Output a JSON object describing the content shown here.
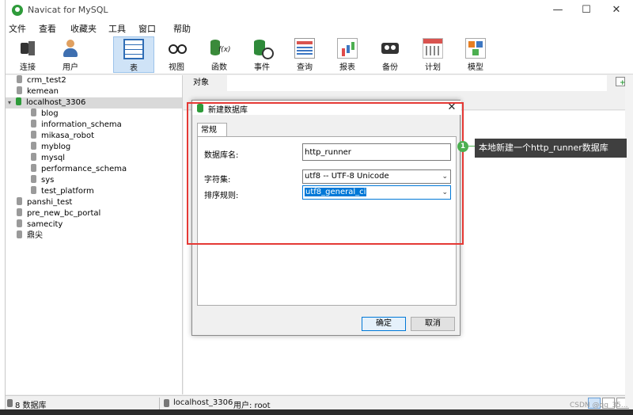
{
  "window": {
    "title": "Navicat for MySQL",
    "minimize": "—",
    "maximize": "☐",
    "close": "✕"
  },
  "menu": [
    "文件",
    "查看",
    "收藏夹",
    "工具",
    "窗口",
    "帮助"
  ],
  "toolbar": [
    {
      "label": "连接",
      "icon": "plug-icon"
    },
    {
      "label": "用户",
      "icon": "user-icon"
    },
    {
      "label": "表",
      "icon": "table-icon",
      "active": true
    },
    {
      "label": "视图",
      "icon": "view-icon"
    },
    {
      "label": "函数",
      "icon": "function-icon"
    },
    {
      "label": "事件",
      "icon": "event-icon"
    },
    {
      "label": "查询",
      "icon": "query-icon"
    },
    {
      "label": "报表",
      "icon": "report-icon"
    },
    {
      "label": "备份",
      "icon": "backup-icon"
    },
    {
      "label": "计划",
      "icon": "schedule-icon"
    },
    {
      "label": "模型",
      "icon": "model-icon"
    }
  ],
  "tree": {
    "items": [
      {
        "label": "crm_test2",
        "level": 0
      },
      {
        "label": "kemean",
        "level": 0
      },
      {
        "label": "localhost_3306",
        "level": 0,
        "expanded": true,
        "selected": true,
        "connected": true
      },
      {
        "label": "blog",
        "level": 1
      },
      {
        "label": "information_schema",
        "level": 1
      },
      {
        "label": "mikasa_robot",
        "level": 1
      },
      {
        "label": "myblog",
        "level": 1
      },
      {
        "label": "mysql",
        "level": 1
      },
      {
        "label": "performance_schema",
        "level": 1
      },
      {
        "label": "sys",
        "level": 1
      },
      {
        "label": "test_platform",
        "level": 1
      },
      {
        "label": "panshi_test",
        "level": 0
      },
      {
        "label": "pre_new_bc_portal",
        "level": 0
      },
      {
        "label": "samecity",
        "level": 0
      },
      {
        "label": "鼎尖",
        "level": 0
      }
    ]
  },
  "right_pane": {
    "tab_label": "对象"
  },
  "dialog": {
    "title": "新建数据库",
    "close": "✕",
    "tab": "常规",
    "fields": {
      "db_name_label": "数据库名:",
      "db_name_value": "http_runner",
      "charset_label": "字符集:",
      "charset_value": "utf8 -- UTF-8 Unicode",
      "collation_label": "排序规则:",
      "collation_value": "utf8_general_ci"
    },
    "ok": "确定",
    "cancel": "取消"
  },
  "annotation": {
    "badge": "1",
    "text": "本地新建一个http_runner数据库"
  },
  "statusbar": {
    "count": "8 数据库",
    "connection": "localhost_3306",
    "user": "用户: root"
  },
  "watermark": "CSDN @qq_35..."
}
